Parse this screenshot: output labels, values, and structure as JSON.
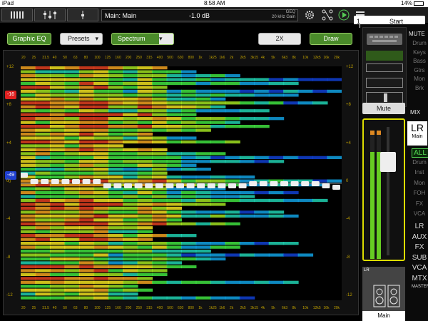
{
  "status_bar": {
    "device": "iPad",
    "time": "8:58 AM",
    "battery": "14%"
  },
  "toolbar": {
    "mix_name": "Main: Main",
    "level": "-1.0 dB",
    "geq_line1": "GEQ",
    "geq_line2": "20 kHz Gain",
    "scene_number": "1",
    "scene_label": "Start",
    "icons": [
      "mixer-icon",
      "faders-icon",
      "single-fader-icon",
      "gear-icon",
      "routing-icon",
      "play-icon",
      "list-icon"
    ]
  },
  "controls": {
    "graphic_eq": "Graphic EQ",
    "presets": "Presets",
    "spectrum": "Spectrum",
    "x2": "2X",
    "draw": "Draw"
  },
  "graph": {
    "freq_labels": [
      "20",
      "25",
      "31.5",
      "40",
      "50",
      "63",
      "80",
      "100",
      "125",
      "160",
      "200",
      "250",
      "315",
      "400",
      "500",
      "630",
      "800",
      "1k",
      "1k25",
      "1k6",
      "2k",
      "2k5",
      "3k15",
      "4k",
      "5k",
      "6k3",
      "8k",
      "10k",
      "12k5",
      "16k",
      "20k"
    ],
    "db_labels": [
      "+12",
      "+8",
      "+4",
      "0",
      "-4",
      "-8",
      "-12"
    ],
    "marker_top": "-16",
    "marker_mid": "-49",
    "marker_mid_sub": "0",
    "accent_red": "#e02020",
    "accent_blue": "#2040d0"
  },
  "right_panel": {
    "mute_header": "MUTE",
    "mute_groups": [
      "Drum",
      "Keys",
      "Bass",
      "Gtrs",
      "Mon",
      "Brk"
    ],
    "mute_button": "Mute",
    "mix_header": "MIX",
    "mix_lr": "LR",
    "mix_main": "Main",
    "mix_filters": [
      "ALL",
      "Drum",
      "Inst",
      "Mon",
      "FOH",
      "FX",
      "VCA"
    ],
    "mix_types": [
      "LR",
      "AUX",
      "FX",
      "SUB",
      "VCA",
      "MTX",
      "MASTERS"
    ],
    "strip_label": "LR",
    "strip_name": "Main"
  }
}
